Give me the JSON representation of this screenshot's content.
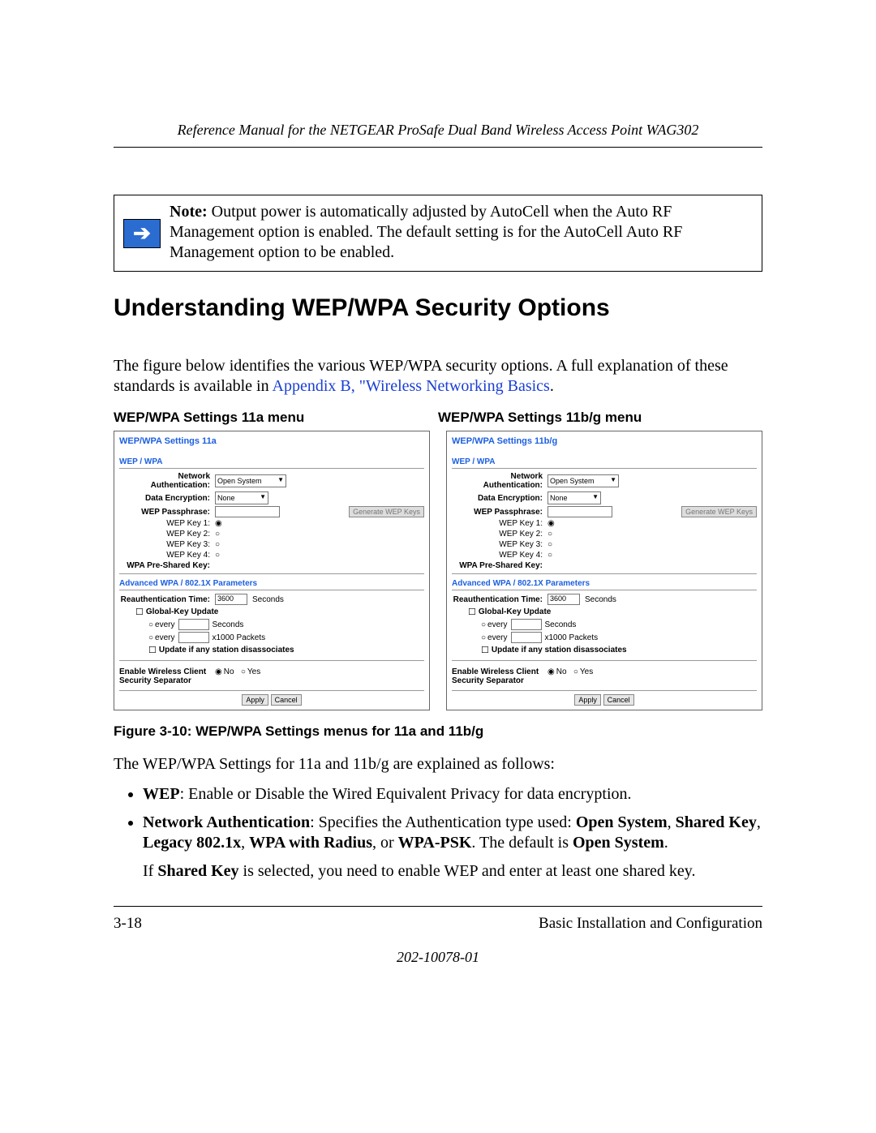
{
  "header": {
    "title": "Reference Manual for the NETGEAR ProSafe Dual Band Wireless Access Point WAG302"
  },
  "note": {
    "label": "Note:",
    "text": " Output power is automatically adjusted by AutoCell when the Auto RF Management option is enabled. The default setting is for the AutoCell Auto RF Management option to be enabled."
  },
  "section": {
    "title": "Understanding WEP/WPA Security Options"
  },
  "intro": {
    "text_before_link": "The figure below identifies the various WEP/WPA security options. A full explanation of these standards is available in ",
    "link": "Appendix B, \"Wireless Networking Basics",
    "text_after_link": "."
  },
  "columns": {
    "left": "WEP/WPA Settings 11a menu",
    "right": "WEP/WPA Settings 11b/g menu"
  },
  "panels": [
    {
      "title": "WEP/WPA Settings 11a",
      "wep_section": "WEP / WPA",
      "rows": {
        "network_auth_label": "Network Authentication:",
        "network_auth_value": "Open System",
        "data_enc_label": "Data Encryption:",
        "data_enc_value": "None",
        "wep_passphrase_label": "WEP Passphrase:",
        "gen_button": "Generate WEP Keys",
        "key1": "WEP Key 1:",
        "key2": "WEP Key 2:",
        "key3": "WEP Key 3:",
        "key4": "WEP Key 4:",
        "wpa_psk": "WPA Pre-Shared Key:"
      },
      "adv_section": "Advanced WPA / 802.1X Parameters",
      "adv": {
        "reauth_label": "Reauthentication Time:",
        "reauth_value": "3600",
        "reauth_unit": "Seconds",
        "gku_label": "Global-Key Update",
        "every": "every",
        "seconds_unit": "Seconds",
        "packets_unit": "x1000 Packets",
        "update_dis": "Update if any station disassociates"
      },
      "sep": {
        "label": "Enable Wireless Client Security Separator",
        "no": "No",
        "yes": "Yes"
      },
      "buttons": {
        "apply": "Apply",
        "cancel": "Cancel"
      }
    },
    {
      "title": "WEP/WPA Settings 11b/g",
      "wep_section": "WEP / WPA",
      "rows": {
        "network_auth_label": "Network Authentication:",
        "network_auth_value": "Open System",
        "data_enc_label": "Data Encryption:",
        "data_enc_value": "None",
        "wep_passphrase_label": "WEP Passphrase:",
        "gen_button": "Generate WEP Keys",
        "key1": "WEP Key 1:",
        "key2": "WEP Key 2:",
        "key3": "WEP Key 3:",
        "key4": "WEP Key 4:",
        "wpa_psk": "WPA Pre-Shared Key:"
      },
      "adv_section": "Advanced WPA / 802.1X Parameters",
      "adv": {
        "reauth_label": "Reauthentication Time:",
        "reauth_value": "3600",
        "reauth_unit": "Seconds",
        "gku_label": "Global-Key Update",
        "every": "every",
        "seconds_unit": "Seconds",
        "packets_unit": "x1000 Packets",
        "update_dis": "Update if any station disassociates"
      },
      "sep": {
        "label": "Enable Wireless Client Security Separator",
        "no": "No",
        "yes": "Yes"
      },
      "buttons": {
        "apply": "Apply",
        "cancel": "Cancel"
      }
    }
  ],
  "figure_caption": "Figure 3-10:  WEP/WPA Settings menus for 11a and 11b/g",
  "after_figure": "The WEP/WPA Settings for 11a and 11b/g are explained as follows:",
  "bullets": [
    {
      "bold1": "WEP",
      "rest": ": Enable or Disable the Wired Equivalent Privacy for data encryption."
    },
    {
      "bold1": "Network Authentication",
      "rest_a": ": Specifies the Authentication type used: ",
      "b1": "Open System",
      "c1": ", ",
      "b2": "Shared Key",
      "c2": ", ",
      "b3": "Legacy 802.1x",
      "c3": ", ",
      "b4": "WPA with Radius",
      "c4": ", or ",
      "b5": "WPA-PSK",
      "c5": ". The default is ",
      "b6": "Open System",
      "c6": ".",
      "sub_before": "If ",
      "sub_bold": "Shared Key",
      "sub_after": " is selected, you need to enable WEP and enter at least one shared key."
    }
  ],
  "footer": {
    "left": "3-18",
    "right": "Basic Installation and Configuration",
    "docnum": "202-10078-01"
  }
}
